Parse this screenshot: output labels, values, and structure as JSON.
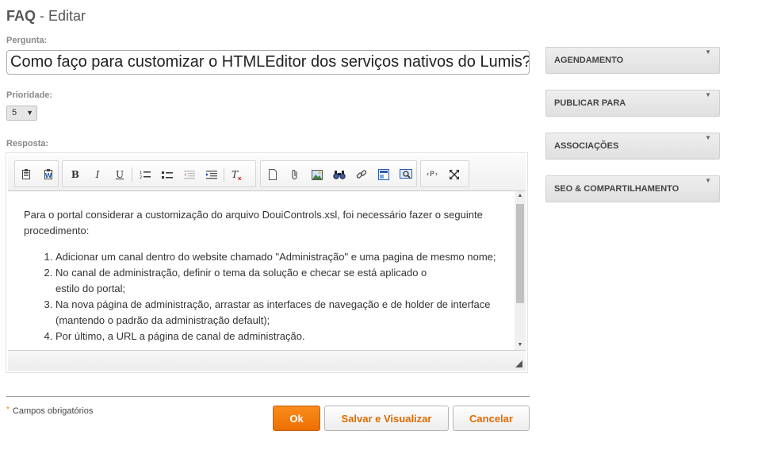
{
  "header": {
    "module": "FAQ",
    "action": " - Editar"
  },
  "form": {
    "question_label": "Pergunta:",
    "question_value": "Como faço para customizar o HTMLEditor dos serviços nativos do Lumis?",
    "priority_label": "Prioridade:",
    "priority_value": "5",
    "answer_label": "Resposta:"
  },
  "editor": {
    "toolbar_icons": [
      "template-icon",
      "paste-word-icon",
      "bold-icon",
      "italic-icon",
      "underline-icon",
      "numbered-list-icon",
      "bulleted-list-icon",
      "outdent-icon",
      "indent-icon",
      "remove-format-icon",
      "new-page-icon",
      "attachment-icon",
      "image-icon",
      "find-icon",
      "link-icon",
      "insert-media-icon",
      "preview-icon",
      "source-code-icon",
      "maximize-icon"
    ],
    "paragraph": "Para o portal considerar a customização do arquivo DouiControls.xsl, foi necessário fazer o seguinte procedimento:",
    "steps": [
      "Adicionar um canal dentro do website chamado \"Administração\" e uma pagina de mesmo nome;",
      "No canal de administração, definir o tema da solução e checar se está aplicado o estilo do portal;",
      "Na nova página de administração, arrastar as interfaces de navegação e de holder de interface (mantendo o padrão da administração default);",
      "Por último, a URL a página de canal de administração."
    ]
  },
  "footer": {
    "required_note": "Campos obrigatórios",
    "ok_label": "Ok",
    "save_view_label": "Salvar e Visualizar",
    "cancel_label": "Cancelar"
  },
  "side_panels": [
    {
      "label": "AGENDAMENTO"
    },
    {
      "label": "PUBLICAR PARA"
    },
    {
      "label": "ASSOCIAÇÕES"
    },
    {
      "label": "SEO & COMPARTILHAMENTO"
    }
  ],
  "colors": {
    "accent": "#f07f0e",
    "label": "#8a8a8a"
  }
}
